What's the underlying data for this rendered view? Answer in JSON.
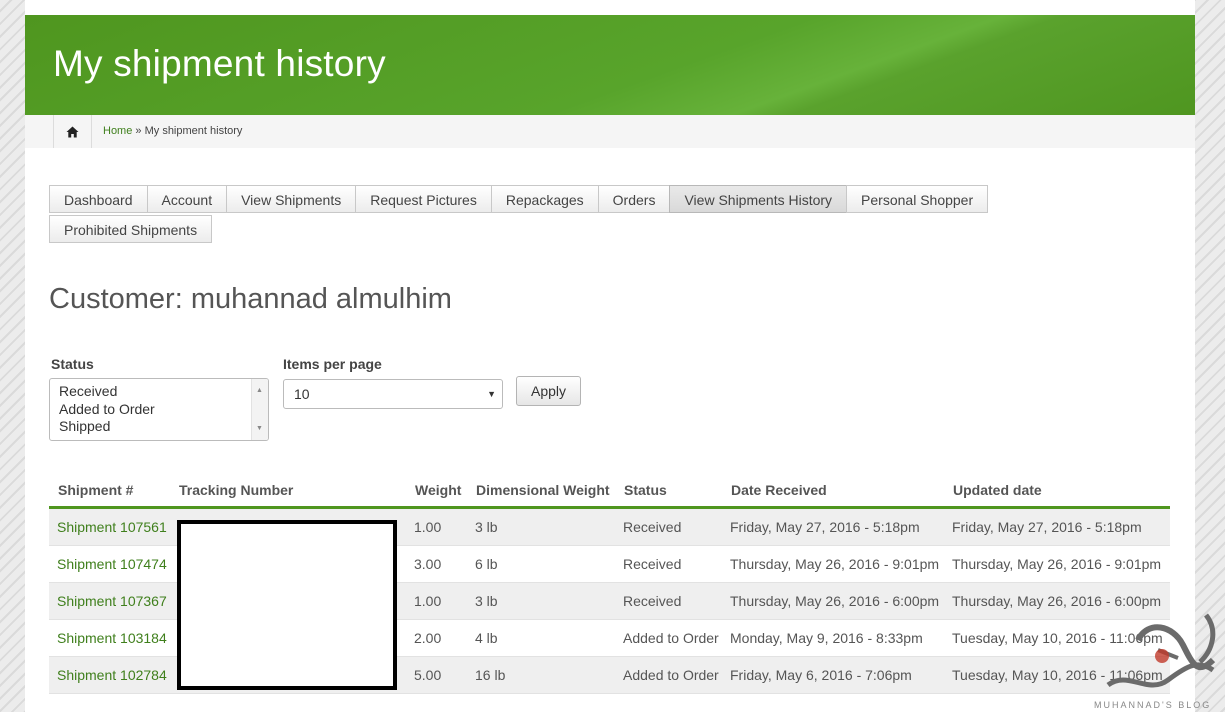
{
  "header": {
    "title": "My shipment history"
  },
  "breadcrumb": {
    "home": "Home",
    "separator": "»",
    "current": "My shipment history"
  },
  "tabs": [
    {
      "label": "Dashboard"
    },
    {
      "label": "Account"
    },
    {
      "label": "View Shipments"
    },
    {
      "label": "Request Pictures"
    },
    {
      "label": "Repackages"
    },
    {
      "label": "Orders"
    },
    {
      "label": "View Shipments History",
      "active": true
    },
    {
      "label": "Personal Shopper"
    },
    {
      "label": "Prohibited Shipments"
    }
  ],
  "customer": {
    "heading": "Customer: muhannad almulhim"
  },
  "filters": {
    "status_label": "Status",
    "status_options": [
      "Received",
      "Added to Order",
      "Shipped"
    ],
    "items_label": "Items per page",
    "items_value": "10",
    "apply_label": "Apply"
  },
  "table": {
    "headers": [
      "Shipment #",
      "Tracking Number",
      "Weight",
      "Dimensional Weight",
      "Status",
      "Date Received",
      "Updated date"
    ],
    "rows": [
      {
        "shipment": "Shipment 107561",
        "tracking": "",
        "weight": "1.00",
        "dim_weight": "3 lb",
        "status": "Received",
        "date_received": "Friday, May 27, 2016 - 5:18pm",
        "updated": "Friday, May 27, 2016 - 5:18pm"
      },
      {
        "shipment": "Shipment 107474",
        "tracking": "",
        "weight": "3.00",
        "dim_weight": "6 lb",
        "status": "Received",
        "date_received": "Thursday, May 26, 2016 - 9:01pm",
        "updated": "Thursday, May 26, 2016 - 9:01pm"
      },
      {
        "shipment": "Shipment 107367",
        "tracking": "",
        "weight": "1.00",
        "dim_weight": "3 lb",
        "status": "Received",
        "date_received": "Thursday, May 26, 2016 - 6:00pm",
        "updated": "Thursday, May 26, 2016 - 6:00pm"
      },
      {
        "shipment": "Shipment 103184",
        "tracking": "",
        "weight": "2.00",
        "dim_weight": "4 lb",
        "status": "Added to Order",
        "date_received": "Monday, May 9, 2016 - 8:33pm",
        "updated": "Tuesday, May 10, 2016 - 11:06pm"
      },
      {
        "shipment": "Shipment 102784",
        "tracking": "",
        "weight": "5.00",
        "dim_weight": "16 lb",
        "status": "Added to Order",
        "date_received": "Friday, May 6, 2016 - 7:06pm",
        "updated": "Tuesday, May 10, 2016 - 11:06pm"
      }
    ]
  },
  "watermark": {
    "text": "MUHANNAD'S BLOG"
  },
  "icons": {
    "home": "home-icon",
    "dropdown": "chevron-down-icon",
    "scroll_up": "arrow-up-icon",
    "scroll_down": "arrow-down-icon"
  },
  "colors": {
    "brand_green": "#4f961f",
    "link_green": "#3f7f1c",
    "row_stripe": "#efefef"
  }
}
